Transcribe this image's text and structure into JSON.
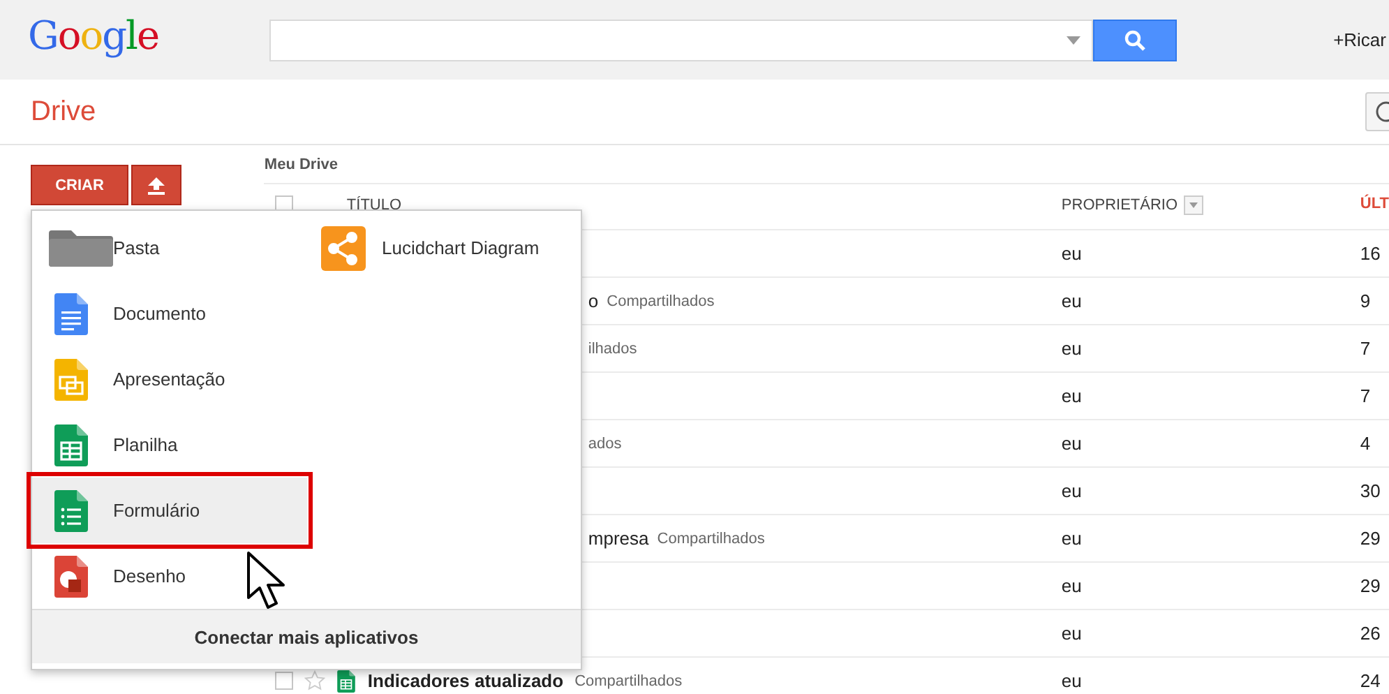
{
  "header": {
    "logo": "Google",
    "user": "+Ricar"
  },
  "app_bar": {
    "title": "Drive"
  },
  "sidebar": {
    "create_button": "CRIAR"
  },
  "breadcrumb": "Meu Drive",
  "table": {
    "select_all": {
      "checked": false
    },
    "columns": [
      {
        "label": "TÍTULO",
        "sorted": false,
        "has_menu": false
      },
      {
        "label": "PROPRIETÁRIO",
        "sorted": false,
        "has_menu": true
      },
      {
        "label": "ÚLT",
        "sorted": true,
        "has_menu": false
      }
    ],
    "rows": [
      {
        "kind": "covered",
        "owner": "eu",
        "date": "16"
      },
      {
        "kind": "covered",
        "title": "o",
        "shared": "Compartilhados",
        "owner": "eu",
        "date": "9"
      },
      {
        "kind": "covered",
        "shared": "ilhados",
        "owner": "eu",
        "date": "7"
      },
      {
        "kind": "covered",
        "owner": "eu",
        "date": "7"
      },
      {
        "kind": "covered",
        "shared": "ados",
        "owner": "eu",
        "date": "4"
      },
      {
        "kind": "covered",
        "owner": "eu",
        "date": "30"
      },
      {
        "kind": "covered",
        "title": "mpresa",
        "shared": "Compartilhados",
        "owner": "eu",
        "date": "29"
      },
      {
        "kind": "covered",
        "owner": "eu",
        "date": "29"
      },
      {
        "kind": "covered",
        "owner": "eu",
        "date": "26"
      },
      {
        "kind": "full",
        "checked": false,
        "starred": false,
        "bold": true,
        "title": "Indicadores atualizado",
        "shared": "Compartilhados",
        "owner": "eu",
        "date": "24"
      }
    ]
  },
  "create_menu": {
    "items": [
      {
        "label": "Pasta",
        "kind": "folder",
        "selected": false
      },
      {
        "label": "Documento",
        "kind": "doc",
        "selected": false
      },
      {
        "label": "Apresentação",
        "kind": "slides",
        "selected": false
      },
      {
        "label": "Planilha",
        "kind": "sheet",
        "selected": false
      },
      {
        "label": "Formulário",
        "kind": "form",
        "selected": true
      },
      {
        "label": "Desenho",
        "kind": "drawing",
        "selected": false
      }
    ],
    "apps": [
      {
        "label": "Lucidchart Diagram",
        "kind": "lucidchart"
      }
    ],
    "footer": "Conectar mais aplicativos"
  }
}
